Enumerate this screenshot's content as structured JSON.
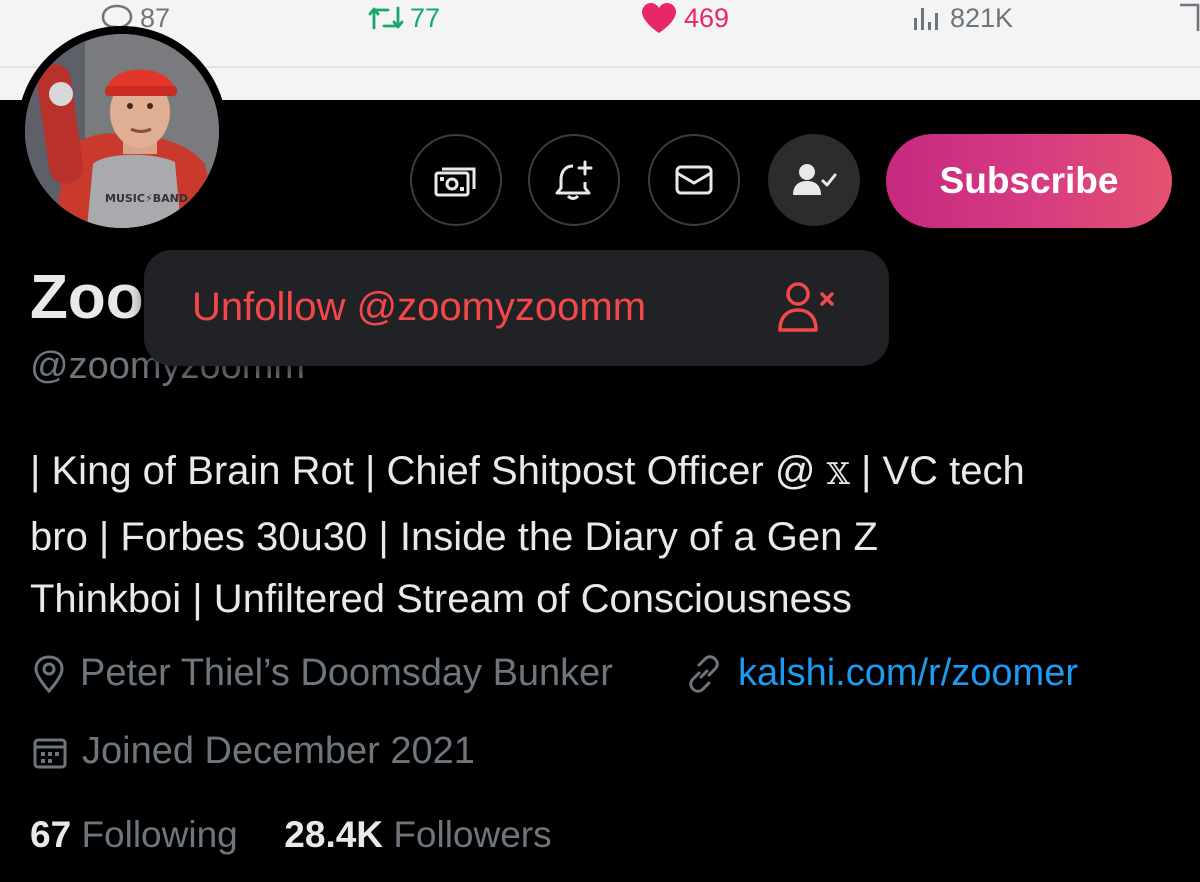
{
  "post_stats": {
    "replies": "87",
    "reposts": "77",
    "likes": "469",
    "views": "821K"
  },
  "profile": {
    "avatar_text": "MUSIC⚡BAND",
    "name_visible": "Zoo",
    "handle": "@zoomyzoomm",
    "subscribe_label": "Subscribe",
    "bio": {
      "line1_a": "| King of Brain Rot | Chief Shitpost Officer @",
      "line1_x": "𝕏",
      "line1_b": "| VC tech",
      "line2": "bro | Forbes 30u30 | Inside the Diary of a Gen Z",
      "line3": "Thinkboi | Unfiltered Stream of Consciousness"
    },
    "location": "Peter Thiel’s Doomsday Bunker",
    "website": "kalshi.com/r/zoomer",
    "joined": "Joined December 2021",
    "following_count": "67",
    "following_label": "Following",
    "followers_count": "28.4K",
    "followers_label": "Followers"
  },
  "menu": {
    "unfollow_label": "Unfollow @zoomyzoomm"
  },
  "icons": {
    "reply": "comment-bubble-icon",
    "repost": "repost-icon",
    "like": "heart-icon",
    "views": "bar-chart-icon",
    "tip": "money-icon",
    "notify": "bell-plus-icon",
    "message": "envelope-icon",
    "following": "person-check-icon",
    "unfollow": "person-x-icon",
    "location": "location-pin-icon",
    "link": "link-icon",
    "calendar": "calendar-icon"
  },
  "colors": {
    "background": "#000000",
    "accent_blue": "#1d9bf0",
    "like_pink": "#e8266a",
    "repost_green": "#17a86a",
    "danger_red": "#f3484b",
    "subscribe_gradient_start": "#c6287f",
    "subscribe_gradient_end": "#e3526e"
  }
}
